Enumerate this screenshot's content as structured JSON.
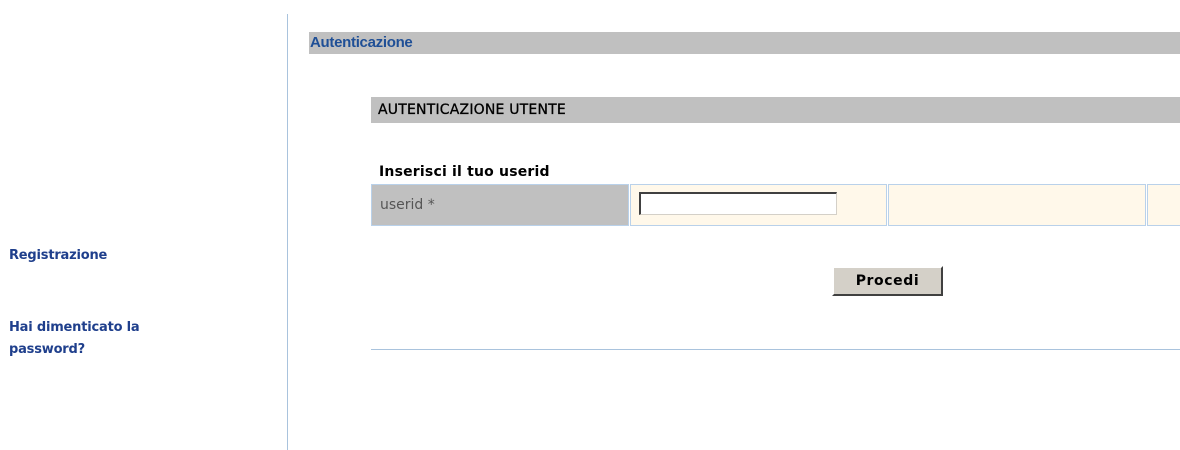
{
  "sidebar": {
    "links": [
      {
        "label": "Registrazione"
      },
      {
        "label": "Hai dimenticato la password?"
      }
    ]
  },
  "main": {
    "title": "Autenticazione",
    "section_title": "AUTENTICAZIONE UTENTE",
    "form": {
      "prompt": "Inserisci il tuo userid",
      "field_label": "userid *",
      "field_value": "",
      "submit_label": "Procedi"
    }
  },
  "colors": {
    "link": "#1f3f8c",
    "title": "#1f4f96",
    "bar_background": "#c0c0c0",
    "input_cell_background": "#fff8ea",
    "divider": "#a9c3dd"
  }
}
